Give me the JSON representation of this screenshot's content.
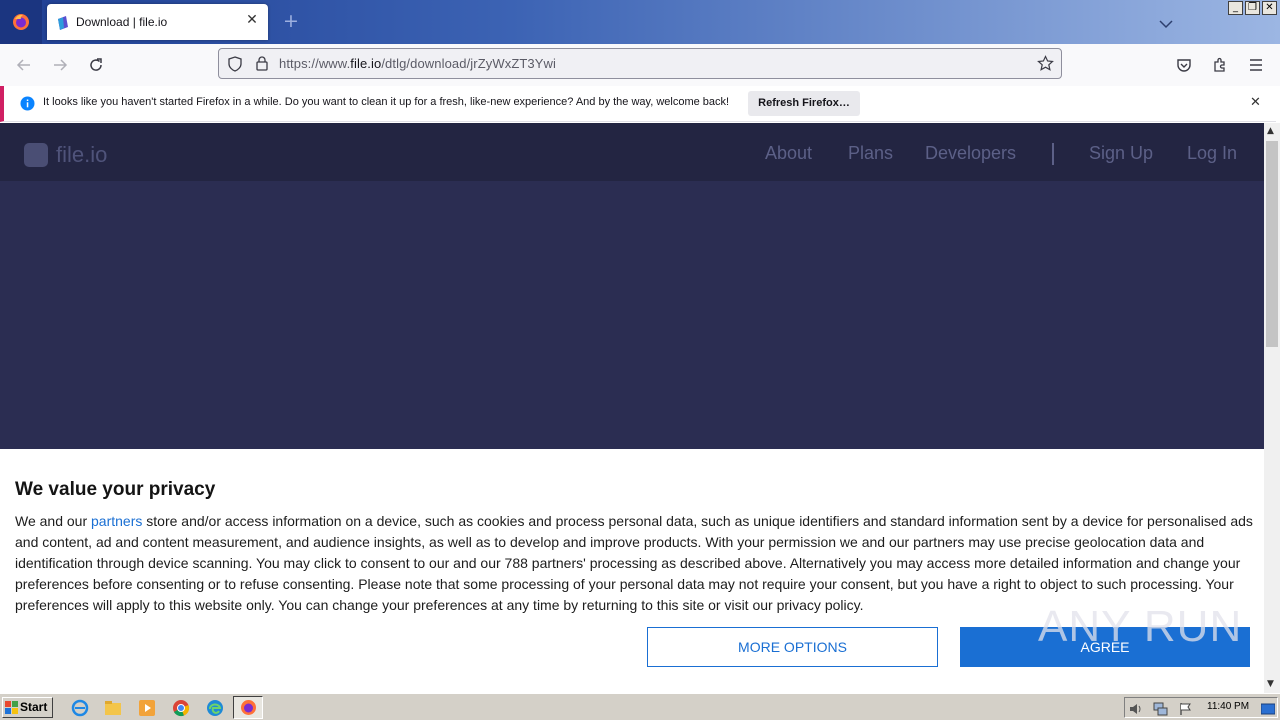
{
  "browser": {
    "tab_title": "Download | file.io",
    "url_prefix": "https://www.",
    "url_domain": "file.io",
    "url_path": "/dtlg/download/jrZyWxZT3Ywi",
    "notification": {
      "message": "It looks like you haven't started Firefox in a while. Do you want to clean it up for a fresh, like-new experience? And by the way, welcome back!",
      "button_label": "Refresh Firefox…"
    }
  },
  "site": {
    "logo": "file.io",
    "nav": [
      "About",
      "Plans",
      "Developers",
      "Sign Up",
      "Log In"
    ]
  },
  "consent": {
    "title": "We value your privacy",
    "body_before_link": "We and our ",
    "link_text": "partners",
    "body_after_link": " store and/or access information on a device, such as cookies and process personal data, such as unique identifiers and standard information sent by a device for personalised ads and content, ad and content measurement, and audience insights, as well as to develop and improve products. With your permission we and our partners may use precise geolocation data and identification through device scanning. You may click to consent to our and our 788 partners' processing as described above. Alternatively you may access more detailed information and change your preferences before consenting or to refuse consenting. Please note that some processing of your personal data may not require your consent, but you have a right to object to such processing. Your preferences will apply to this website only. You can change your preferences at any time by returning to this site or visit our privacy policy.",
    "more_options": "MORE OPTIONS",
    "agree": "AGREE"
  },
  "watermark": "ANY RUN",
  "taskbar": {
    "start": "Start",
    "clock": "11:40 PM"
  },
  "colors": {
    "page_bg": "#2b2d52",
    "site_nav_bg": "#232542",
    "accent": "#1a6fd3",
    "notification_bar": "#d01f63"
  }
}
